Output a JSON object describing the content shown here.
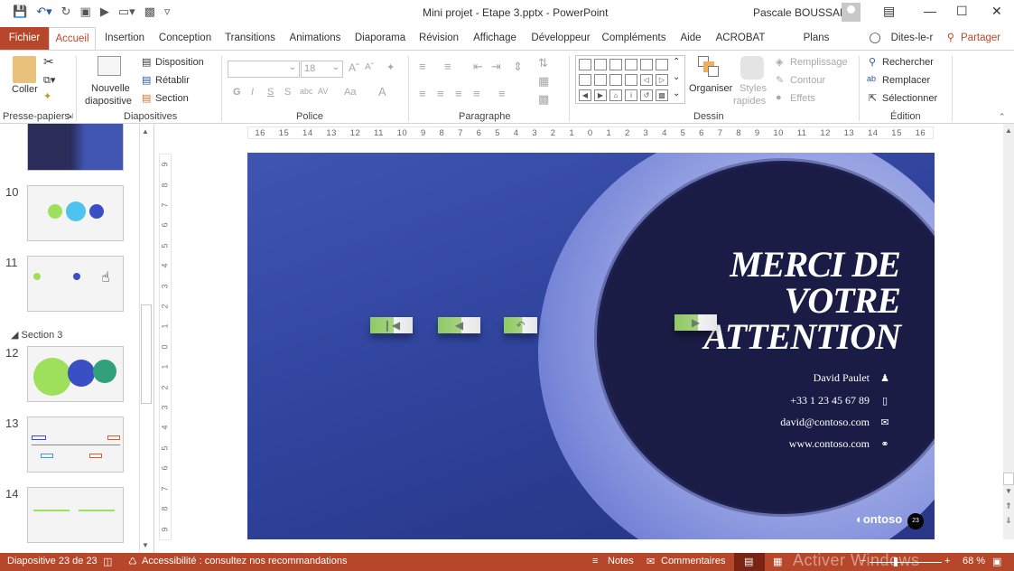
{
  "window": {
    "title": "Mini projet - Etape 3.pptx  -  PowerPoint",
    "user_name": "Pascale BOUSSARD",
    "controls": [
      "ribbon-display-options",
      "minimize",
      "maximize",
      "close"
    ]
  },
  "quick_access": [
    "save",
    "undo",
    "redo",
    "present-from-start",
    "presenter",
    "screen",
    "format-painter",
    "customize"
  ],
  "tabs": [
    {
      "label": "Fichier"
    },
    {
      "label": "Accueil",
      "active": true
    },
    {
      "label": "Insertion"
    },
    {
      "label": "Conception"
    },
    {
      "label": "Transitions"
    },
    {
      "label": "Animations"
    },
    {
      "label": "Diaporama"
    },
    {
      "label": "Révision"
    },
    {
      "label": "Affichage"
    },
    {
      "label": "Développeur"
    },
    {
      "label": "Compléments"
    },
    {
      "label": "Aide"
    },
    {
      "label": "ACROBAT"
    },
    {
      "label": "Plans conceptuels"
    },
    {
      "label": "Dites-le-r"
    },
    {
      "label": "Partager"
    }
  ],
  "ribbon": {
    "clipboard": {
      "paste": "Coller",
      "group": "Presse-papiers"
    },
    "slides": {
      "new_slide_1": "Nouvelle",
      "new_slide_2": "diapositive",
      "layout": "Disposition",
      "reset": "Rétablir",
      "section": "Section",
      "group": "Diapositives"
    },
    "font": {
      "font_name": "",
      "font_size": "18",
      "bold": "G",
      "italic": "I",
      "underline": "S",
      "shadow": "S",
      "strike": "abc",
      "spacing": "AV",
      "case": "Aa",
      "color": "A",
      "group": "Police"
    },
    "paragraph": {
      "group": "Paragraphe"
    },
    "drawing": {
      "arrange": "Organiser",
      "quick_styles_1": "Styles",
      "quick_styles_2": "rapides",
      "fill": "Remplissage",
      "outline": "Contour",
      "effects": "Effets",
      "group": "Dessin"
    },
    "editing": {
      "find": "Rechercher",
      "replace": "Remplacer",
      "select": "Sélectionner",
      "group": "Édition"
    }
  },
  "thumbnails": {
    "section_label": "Section 3",
    "items": [
      {
        "num": "",
        "title": "slide 9"
      },
      {
        "num": "10",
        "title": "slide 10"
      },
      {
        "num": "11",
        "title": "slide 11"
      },
      {
        "num": "12",
        "title": "slide 12"
      },
      {
        "num": "13",
        "title": "slide 13"
      },
      {
        "num": "14",
        "title": "slide 14"
      }
    ]
  },
  "rulers": {
    "horizontal": [
      "16",
      "15",
      "14",
      "13",
      "12",
      "11",
      "10",
      "9",
      "8",
      "7",
      "6",
      "5",
      "4",
      "3",
      "2",
      "1",
      "0",
      "1",
      "2",
      "3",
      "4",
      "5",
      "6",
      "7",
      "8",
      "9",
      "10",
      "11",
      "12",
      "13",
      "14",
      "15",
      "16"
    ],
    "vertical": [
      "9",
      "8",
      "7",
      "6",
      "5",
      "4",
      "3",
      "2",
      "1",
      "0",
      "1",
      "2",
      "3",
      "4",
      "5",
      "6",
      "7",
      "8",
      "9"
    ]
  },
  "slide": {
    "title_line1": "MERCI DE",
    "title_line2": "VOTRE",
    "title_line3": "ATTENTION",
    "contact": [
      {
        "text": "David Paulet",
        "icon": "person-icon"
      },
      {
        "text": "+33 1 23 45 67 89",
        "icon": "phone-icon"
      },
      {
        "text": "david@contoso.com",
        "icon": "mail-icon"
      },
      {
        "text": "www.contoso.com",
        "icon": "link-icon"
      }
    ],
    "nav_buttons": [
      "first-slide",
      "previous-slide",
      "return",
      "next-slide"
    ],
    "logo": "contoso",
    "page_number": "23",
    "colors": {
      "background": "#3347a3",
      "disc": "#1b1c45",
      "ring": "#a5b0e8",
      "button_green": "#9ccf74"
    }
  },
  "status": {
    "slide_counter": "Diapositive 23 de 23",
    "accessibility": "Accessibilité : consultez nos recommandations",
    "notes": "Notes",
    "comments": "Commentaires",
    "watermark": "Activer Windows",
    "zoom": "68 %",
    "bar_color": "#b7472a"
  }
}
